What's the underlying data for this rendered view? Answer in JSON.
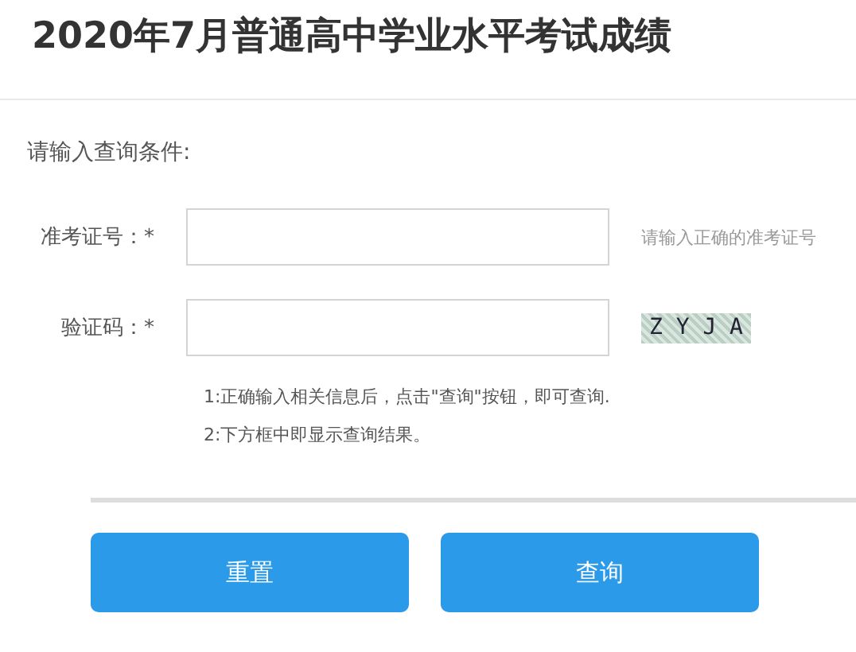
{
  "title": "2020年7月普通高中学业水平考试成绩",
  "section_label": "请输入查询条件:",
  "fields": [
    {
      "label": "准考证号：*",
      "hint": "请输入正确的准考证号",
      "kind": "text"
    },
    {
      "label": "验证码：*",
      "captcha": "Z Y J A",
      "kind": "captcha"
    }
  ],
  "notes": [
    "1:正确输入相关信息后，点击\"查询\"按钮，即可查询.",
    "2:下方框中即显示查询结果。"
  ],
  "buttons": [
    "重置",
    "查询"
  ]
}
